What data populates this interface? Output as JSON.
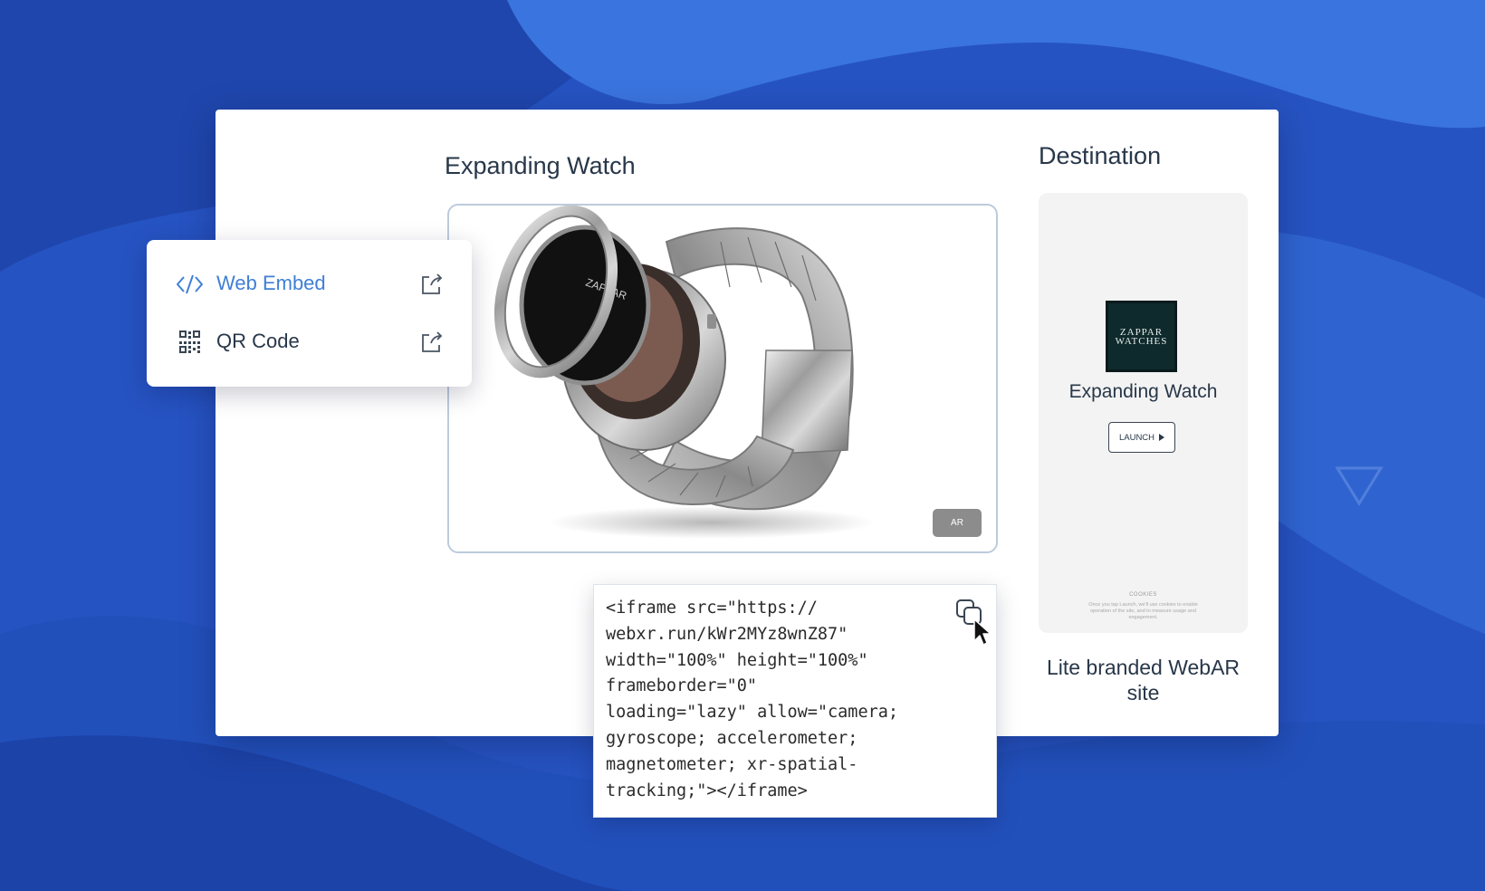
{
  "preview": {
    "title": "Expanding Watch",
    "ar_button_label": "AR"
  },
  "menu": {
    "items": [
      {
        "label": "Web Embed",
        "active": true,
        "icon": "code-icon",
        "action_icon": "external-link-icon"
      },
      {
        "label": "QR Code",
        "active": false,
        "icon": "qr-code-icon",
        "action_icon": "external-link-icon"
      }
    ]
  },
  "embed_code": {
    "lines": [
      "<iframe src=\"https://",
      "webxr.run/kWr2MYz8wnZ87\"",
      "width=\"100%\" height=\"100%\"",
      "frameborder=\"0\"",
      "loading=\"lazy\" allow=\"camera;",
      "gyroscope; accelerometer;",
      "magnetometer; xr-spatial-",
      "tracking;\"></iframe>"
    ],
    "copy_icon": "copy-icon"
  },
  "destination": {
    "title": "Destination",
    "brand_logo_line1": "ZAPPAR",
    "brand_logo_line2": "WATCHES",
    "product_name": "Expanding Watch",
    "launch_label": "LAUNCH",
    "cookies_title": "COOKIES",
    "cookies_text": "Once you tap Launch, we'll use cookies to enable operation of the site, and to measure usage and engagement.",
    "caption": "Lite branded WebAR site"
  },
  "colors": {
    "background_blue": "#2a5cc9",
    "accent_blue": "#3f7fd6",
    "text_dark": "#283749",
    "ar_button_gray": "#8c8c8c"
  }
}
